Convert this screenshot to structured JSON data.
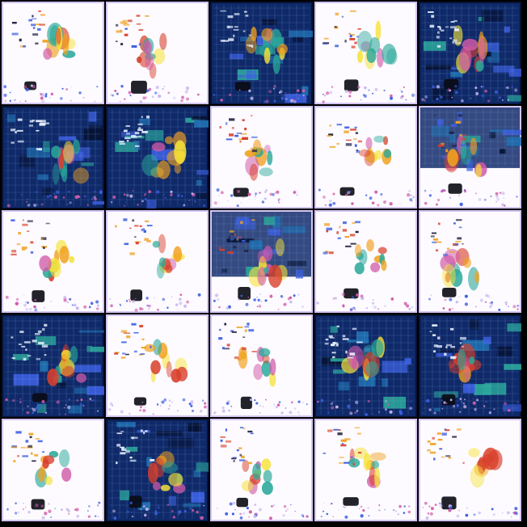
{
  "grid": {
    "rows": 5,
    "cols": 5,
    "background": "#000000"
  },
  "palette": {
    "light_bg": "#fdfbff",
    "dark_bg": "#0a1a3a",
    "dark_blue": "#102a6b",
    "teal": "#2aa89a",
    "navy_stroke": "#061235",
    "orange": "#f0a020",
    "yellow": "#f6e23a",
    "red": "#d8402c",
    "magenta": "#d05aa8",
    "blue_dot": "#3c5fe0",
    "black_blob": "#0a0a14",
    "lavender": "#c8b8f0"
  },
  "tiles": [
    {
      "variant": "light",
      "intensity": 0.9
    },
    {
      "variant": "light",
      "intensity": 0.6
    },
    {
      "variant": "dark",
      "intensity": 0.9
    },
    {
      "variant": "light",
      "intensity": 0.8
    },
    {
      "variant": "dark",
      "intensity": 1.0
    },
    {
      "variant": "dark",
      "intensity": 1.0
    },
    {
      "variant": "dark",
      "intensity": 1.0
    },
    {
      "variant": "light",
      "intensity": 0.7
    },
    {
      "variant": "light",
      "intensity": 0.6
    },
    {
      "variant": "mixed",
      "intensity": 0.8
    },
    {
      "variant": "light",
      "intensity": 0.7
    },
    {
      "variant": "light",
      "intensity": 0.7
    },
    {
      "variant": "mixed",
      "intensity": 0.9
    },
    {
      "variant": "light",
      "intensity": 0.5
    },
    {
      "variant": "light",
      "intensity": 0.9
    },
    {
      "variant": "dark",
      "intensity": 0.9
    },
    {
      "variant": "light",
      "intensity": 0.7
    },
    {
      "variant": "light",
      "intensity": 0.6
    },
    {
      "variant": "dark",
      "intensity": 1.0
    },
    {
      "variant": "dark",
      "intensity": 1.0
    },
    {
      "variant": "light",
      "intensity": 0.7
    },
    {
      "variant": "dark",
      "intensity": 0.9
    },
    {
      "variant": "light",
      "intensity": 0.6
    },
    {
      "variant": "light",
      "intensity": 0.9
    },
    {
      "variant": "light",
      "intensity": 0.9
    }
  ]
}
